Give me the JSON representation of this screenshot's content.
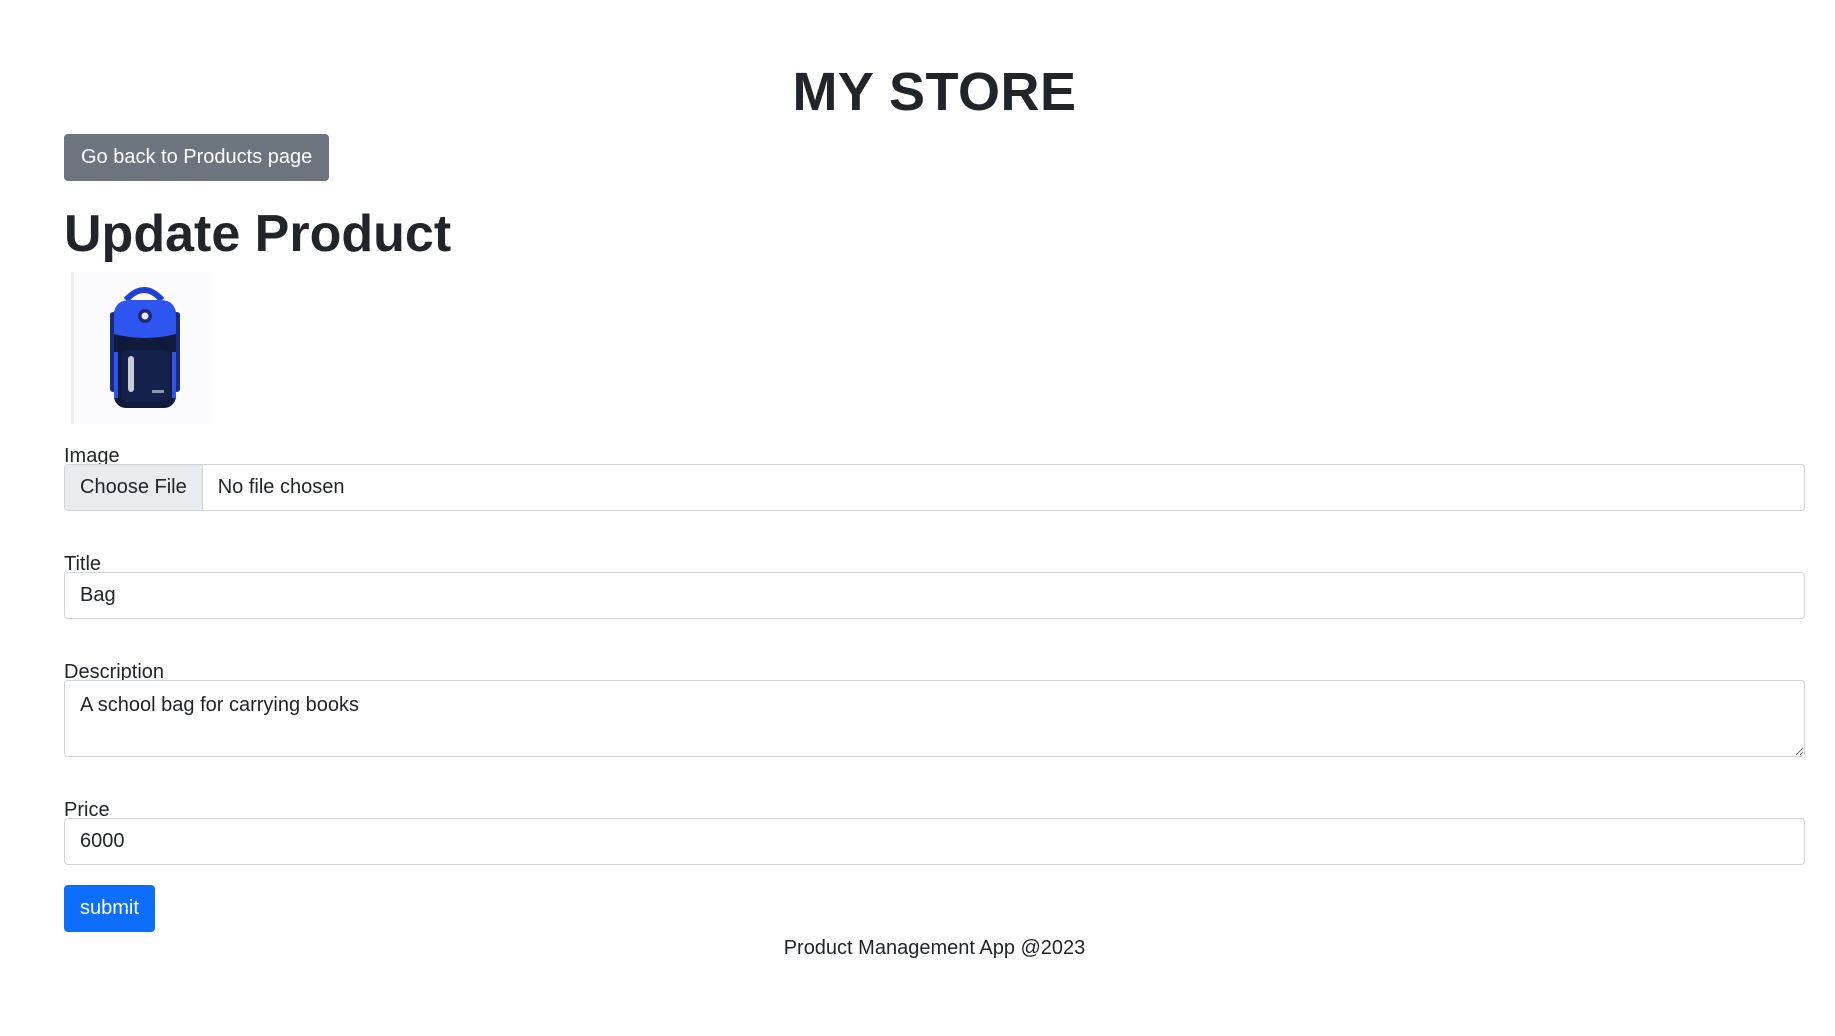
{
  "header": {
    "store_title": "MY STORE"
  },
  "nav": {
    "back_label": "Go back to Products page"
  },
  "page": {
    "title": "Update Product"
  },
  "product_image": {
    "icon": "school-backpack-image",
    "alt": "Bag"
  },
  "form": {
    "image": {
      "label": "Image",
      "button_label": "Choose File",
      "status": "No file chosen"
    },
    "title": {
      "label": "Title",
      "value": "Bag"
    },
    "description": {
      "label": "Description",
      "value": "A school bag for carrying books"
    },
    "price": {
      "label": "Price",
      "value": "6000"
    },
    "submit_label": "submit"
  },
  "footer": {
    "text": "Product Management App @2023"
  },
  "colors": {
    "primary": "#0d6efd",
    "secondary": "#6c757d",
    "border": "#ced4da",
    "text": "#212529"
  }
}
